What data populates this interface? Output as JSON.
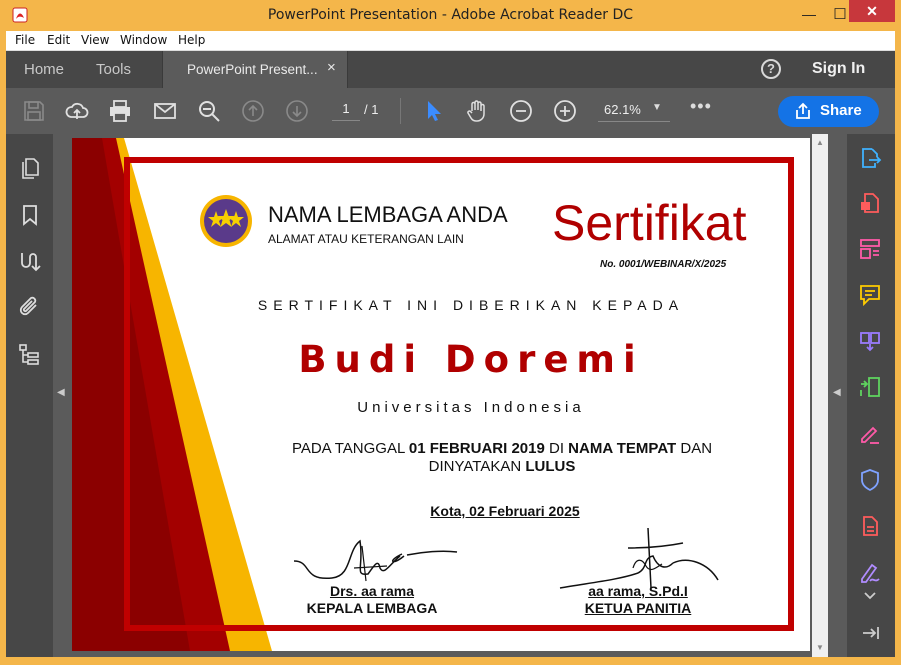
{
  "window": {
    "title": "PowerPoint Presentation - Adobe Acrobat Reader DC",
    "minimize": "—",
    "maximize": "☐",
    "close": "✕"
  },
  "menu": [
    "File",
    "Edit",
    "View",
    "Window",
    "Help"
  ],
  "tabs": {
    "home": "Home",
    "tools": "Tools",
    "document": "PowerPoint Present...",
    "document_close": "×",
    "help": "?",
    "sign_in": "Sign In"
  },
  "toolbar": {
    "page_current": "1",
    "page_total": "/ 1",
    "zoom": "62.1%",
    "share_label": "Share",
    "more": "•••",
    "icons": [
      "save-icon",
      "upload-cloud-icon",
      "print-icon",
      "mail-icon",
      "zoom-search-icon",
      "page-up-icon",
      "page-down-icon",
      "select-cursor-icon",
      "hand-icon",
      "zoom-out-icon",
      "zoom-in-icon"
    ]
  },
  "left_panel_icons": [
    "pages-icon",
    "bookmark-icon",
    "signature-icon",
    "attachment-icon",
    "structure-icon"
  ],
  "right_panel_icons": [
    "export-pdf-icon",
    "create-pdf-icon",
    "edit-pdf-icon",
    "comment-icon",
    "combine-files-icon",
    "organize-pages-icon",
    "fill-sign-icon",
    "protect-icon",
    "compress-icon",
    "sign-icon"
  ],
  "colors": {
    "accent": "#1473e6",
    "cert_red": "#c00000",
    "cert_dark_red": "#8b0000",
    "cert_gold": "#f7b500"
  },
  "certificate": {
    "org_name": "NAMA LEMBAGA ANDA",
    "org_address": "ALAMAT ATAU KETERANGAN LAIN",
    "title": "Sertifikat",
    "number": "No. 0001/WEBINAR/X/2025",
    "given_to": "SERTIFIKAT INI DIBERIKAN KEPADA",
    "recipient": "Budi Doremi",
    "institution": "Universitas Indonesia",
    "desc_prefix": "PADA TANGGAL ",
    "desc_date": "01 FEBRUARI 2019",
    "desc_mid": " DI ",
    "desc_place": "NAMA TEMPAT",
    "desc_mid2": " DAN DINYATAKAN ",
    "desc_status": "LULUS",
    "place_date": "Kota, 02 Februari 2025",
    "signer1_name": "Drs. aa rama",
    "signer1_role": "KEPALA LEMBAGA",
    "signer2_name": "aa rama, S.Pd.I",
    "signer2_role": "KETUA PANITIA"
  }
}
